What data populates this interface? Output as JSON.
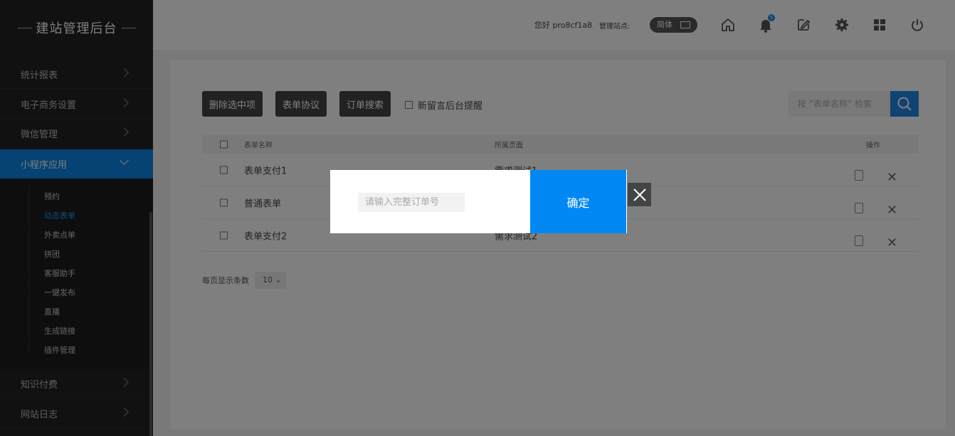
{
  "sidebar": {
    "brand": "建站管理后台",
    "items": [
      {
        "label": "统计报表"
      },
      {
        "label": "电子商务设置"
      },
      {
        "label": "微信管理"
      },
      {
        "label": "小程序应用"
      },
      {
        "label": "知识付费"
      },
      {
        "label": "网站日志"
      }
    ],
    "subitems": [
      "预约",
      "动态表单",
      "外卖点单",
      "拼团",
      "客服助手",
      "一键发布",
      "直播",
      "生成链接",
      "插件管理"
    ],
    "current_subitem": "动态表单"
  },
  "header": {
    "greeting": "您好 pro8cf1a8",
    "site_label": "管理站点:",
    "lang": "简体",
    "notification_count": "5",
    "icons": [
      "home-icon",
      "bell-icon",
      "edit-icon",
      "gear-icon",
      "grid-icon",
      "power-icon"
    ]
  },
  "toolbar": {
    "delete_label": "删除选中项",
    "agreement_label": "表单协议",
    "order_search_label": "订单搜索",
    "remind_label": "新留言后台提醒",
    "search_placeholder": "按 “表单名称” 检索"
  },
  "table": {
    "columns": [
      "表单名称",
      "所属页面",
      "操作"
    ],
    "rows": [
      {
        "name": "表单支付1",
        "page": "需求测试1"
      },
      {
        "name": "普通表单",
        "page": ""
      },
      {
        "name": "表单支付2",
        "page": "需求测试2"
      }
    ]
  },
  "pager": {
    "label": "每页显示条数",
    "value": "10"
  },
  "modal": {
    "placeholder": "请输入完整订单号",
    "confirm_label": "确定"
  },
  "colors": {
    "accent": "#0288f5",
    "sidebar_bg": "#222222",
    "active_nav": "#0d84e6"
  }
}
